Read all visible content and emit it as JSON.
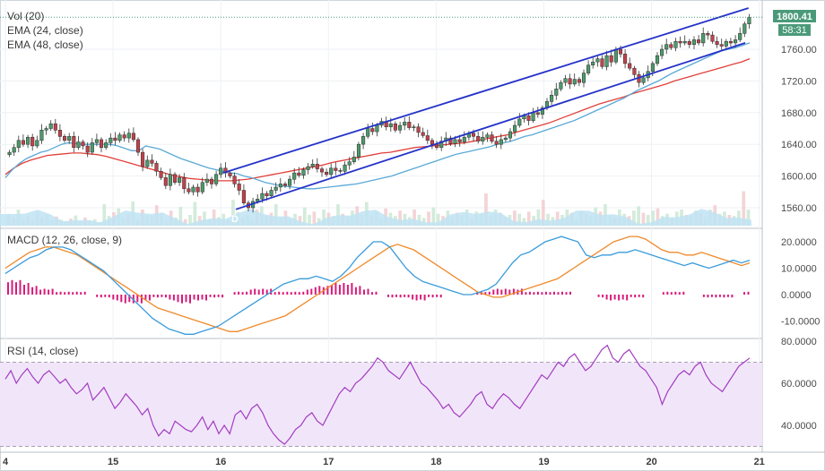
{
  "chart_data": [
    {
      "type": "candlestick",
      "panel": "price",
      "indicator_labels": [
        "Vol (20)",
        "EMA (24, close)",
        "EMA (48, close)"
      ],
      "price_badge": "1800.41",
      "countdown_badge": "58:31",
      "x_tick_labels": [
        "4",
        "15",
        "16",
        "17",
        "18",
        "19",
        "20",
        "21"
      ],
      "y_tick_labels": [
        "1560.00",
        "1600.00",
        "1640.00",
        "1680.00",
        "1720.00",
        "1760.00"
      ],
      "ylim": [
        1540,
        1815
      ],
      "last_price": 1800.41,
      "watermark": "D",
      "closes": [
        1630,
        1636,
        1645,
        1640,
        1649,
        1638,
        1645,
        1658,
        1660,
        1666,
        1658,
        1650,
        1645,
        1650,
        1636,
        1643,
        1638,
        1630,
        1642,
        1646,
        1636,
        1642,
        1648,
        1645,
        1652,
        1648,
        1654,
        1646,
        1630,
        1612,
        1620,
        1616,
        1606,
        1598,
        1588,
        1602,
        1592,
        1598,
        1584,
        1580,
        1586,
        1580,
        1592,
        1596,
        1590,
        1602,
        1610,
        1604,
        1600,
        1590,
        1582,
        1566,
        1560,
        1568,
        1571,
        1578,
        1575,
        1582,
        1586,
        1590,
        1588,
        1596,
        1604,
        1601,
        1608,
        1612,
        1615,
        1609,
        1605,
        1602,
        1610,
        1607,
        1606,
        1614,
        1618,
        1624,
        1640,
        1650,
        1660,
        1656,
        1664,
        1669,
        1662,
        1666,
        1658,
        1664,
        1668,
        1661,
        1662,
        1655,
        1651,
        1645,
        1640,
        1636,
        1644,
        1648,
        1641,
        1646,
        1643,
        1649,
        1654,
        1650,
        1644,
        1649,
        1652,
        1644,
        1640,
        1646,
        1648,
        1656,
        1664,
        1672,
        1676,
        1670,
        1680,
        1678,
        1686,
        1694,
        1702,
        1710,
        1718,
        1723,
        1716,
        1722,
        1718,
        1730,
        1740,
        1744,
        1748,
        1738,
        1752,
        1744,
        1760,
        1754,
        1742,
        1736,
        1728,
        1718,
        1724,
        1732,
        1742,
        1752,
        1760,
        1766,
        1762,
        1770,
        1768,
        1770,
        1766,
        1772,
        1768,
        1780,
        1778,
        1770,
        1766,
        1764,
        1770,
        1768,
        1772,
        1780,
        1792,
        1800
      ],
      "ema24": [
        1598,
        1608,
        1616,
        1622,
        1626,
        1630,
        1632,
        1636,
        1640,
        1642,
        1641,
        1640,
        1640,
        1640,
        1640,
        1640,
        1638,
        1635,
        1632,
        1632,
        1638,
        1636,
        1634,
        1630,
        1626,
        1622,
        1619,
        1616,
        1613,
        1610,
        1608,
        1606,
        1604,
        1603,
        1600,
        1598,
        1595,
        1592,
        1590,
        1588,
        1587,
        1586,
        1585,
        1584,
        1584,
        1585,
        1586,
        1587,
        1588,
        1589,
        1590,
        1592,
        1594,
        1596,
        1598,
        1600,
        1603,
        1606,
        1609,
        1612,
        1615,
        1618,
        1621,
        1624,
        1627,
        1629,
        1631,
        1633,
        1635,
        1637,
        1640,
        1642,
        1644,
        1647,
        1650,
        1652,
        1655,
        1658,
        1661,
        1664,
        1667,
        1670,
        1674,
        1678,
        1682,
        1686,
        1690,
        1694,
        1698,
        1703,
        1708,
        1712,
        1716,
        1720,
        1725,
        1730,
        1734,
        1738,
        1742,
        1746,
        1750,
        1754,
        1758,
        1760,
        1762,
        1765,
        1768
      ],
      "ema48": [
        1602,
        1610,
        1616,
        1620,
        1623,
        1626,
        1627,
        1628,
        1629,
        1629,
        1628,
        1627,
        1625,
        1622,
        1619,
        1616,
        1613,
        1610,
        1607,
        1604,
        1601,
        1599,
        1597,
        1596,
        1595,
        1594,
        1594,
        1594,
        1595,
        1596,
        1598,
        1600,
        1602,
        1604,
        1606,
        1608,
        1610,
        1612,
        1614,
        1617,
        1619,
        1621,
        1623,
        1625,
        1627,
        1629,
        1630,
        1632,
        1634,
        1636,
        1637,
        1638,
        1639,
        1640,
        1641,
        1642,
        1644,
        1646,
        1648,
        1650,
        1652,
        1655,
        1658,
        1661,
        1664,
        1667,
        1671,
        1675,
        1679,
        1683,
        1687,
        1691,
        1694,
        1697,
        1700,
        1704,
        1707,
        1710,
        1713,
        1716,
        1720,
        1723,
        1726,
        1729,
        1732,
        1735,
        1738,
        1741,
        1744,
        1748
      ],
      "volume": [
        22,
        15,
        30,
        12,
        18,
        10,
        25,
        14,
        20,
        9,
        17,
        11,
        8,
        13,
        19,
        7,
        15,
        10,
        12,
        6,
        40,
        18,
        25,
        32,
        14,
        22,
        45,
        12,
        30,
        20,
        16,
        38,
        24,
        10,
        28,
        15,
        35,
        12,
        20,
        44,
        18,
        26,
        12,
        30,
        16,
        22,
        10,
        48,
        25,
        14,
        20,
        12,
        30,
        36,
        18,
        24,
        40,
        16,
        28,
        12,
        22,
        18,
        34,
        20,
        26,
        14,
        30,
        24,
        18,
        40,
        22,
        16,
        28,
        36,
        20,
        44,
        18,
        26,
        14,
        32,
        24,
        18,
        28,
        22,
        16,
        30,
        20,
        14,
        26,
        34,
        22,
        18,
        28,
        16,
        24,
        20,
        30,
        14,
        26,
        22,
        60,
        18,
        30,
        24,
        16,
        20,
        28,
        22,
        14,
        26,
        18,
        30,
        48,
        22,
        16,
        26,
        20,
        30,
        24,
        12,
        28,
        22,
        18,
        34,
        26,
        40,
        20,
        16,
        30,
        22,
        18,
        28,
        36,
        24,
        20,
        28,
        32,
        18,
        22,
        14,
        26,
        30,
        20,
        18,
        28,
        24,
        16,
        30,
        38,
        22,
        26,
        20,
        18,
        28,
        64,
        30
      ],
      "channel_upper": [
        [
          1604,
          16.02
        ],
        [
          1812,
          20.9
        ]
      ],
      "channel_lower": [
        [
          1558,
          16.14
        ],
        [
          1768,
          20.87
        ]
      ]
    },
    {
      "type": "line",
      "panel": "macd",
      "indicator_label": "MACD (12, 26, close, 9)",
      "y_tick_labels": [
        "20.0000",
        "10.0000",
        "0.0000",
        "-10.0000"
      ],
      "ylim": [
        -15,
        25
      ],
      "series": [
        {
          "values": [
            10,
            12,
            14,
            16,
            17,
            18,
            18,
            17,
            16,
            15,
            13,
            11,
            9,
            7,
            5,
            3,
            1,
            -1,
            -3,
            -5,
            -6,
            -7,
            -8,
            -9,
            -10,
            -11,
            -12,
            -13,
            -14,
            -14,
            -13,
            -12,
            -11,
            -10,
            -9,
            -8,
            -6,
            -4,
            -2,
            0,
            2,
            4,
            6,
            8,
            10,
            12,
            14,
            16,
            18,
            19,
            18,
            17,
            15,
            13,
            11,
            9,
            7,
            5,
            3,
            1,
            0,
            -1,
            -1,
            0,
            1,
            2,
            3,
            4,
            5,
            6,
            8,
            10,
            12,
            14,
            16,
            18,
            20,
            21,
            22,
            22,
            21,
            19,
            17,
            16,
            16,
            15,
            15,
            16,
            15,
            14,
            13,
            12,
            11,
            12
          ]
        },
        {
          "values": [
            8,
            10,
            12,
            14,
            15,
            17,
            18,
            18,
            17,
            15,
            13,
            11,
            9,
            6,
            3,
            0,
            -3,
            -6,
            -9,
            -11,
            -13,
            -14,
            -15,
            -15,
            -14,
            -13,
            -12,
            -10,
            -8,
            -6,
            -4,
            -2,
            0,
            2,
            4,
            5,
            6,
            6,
            7,
            6,
            5,
            7,
            10,
            14,
            17,
            20,
            20,
            18,
            14,
            10,
            7,
            5,
            4,
            3,
            2,
            1,
            0,
            0,
            1,
            2,
            4,
            8,
            12,
            15,
            16,
            18,
            20,
            21,
            22,
            21,
            20,
            15,
            14,
            15,
            15,
            16,
            16,
            17,
            16,
            15,
            14,
            13,
            12,
            11,
            12,
            11,
            10,
            11,
            12,
            13,
            12,
            13
          ]
        }
      ],
      "histogram": [
        5,
        5,
        4,
        3,
        2,
        2,
        1,
        1,
        1,
        1,
        0,
        -1,
        -1,
        -2,
        -3,
        -3,
        -3,
        -2,
        -1,
        -1,
        -2,
        -3,
        -3,
        -2,
        -2,
        -1,
        -1,
        0,
        1,
        1,
        2,
        2,
        2,
        1,
        1,
        1,
        1,
        2,
        3,
        3,
        4,
        4,
        4,
        3,
        2,
        1,
        0,
        -1,
        -1,
        -1,
        -2,
        -2,
        -1,
        -1,
        0,
        0,
        0,
        0,
        1,
        1,
        2,
        2,
        2,
        2,
        1,
        1,
        1,
        1,
        1,
        1,
        0,
        0,
        0,
        -1,
        -2,
        -2,
        -2,
        -1,
        -1,
        0,
        0,
        1,
        1,
        1,
        0,
        0,
        -1,
        -1,
        -1,
        -1,
        0,
        1
      ]
    },
    {
      "type": "line",
      "panel": "rsi",
      "indicator_label": "RSI (14, close)",
      "y_tick_labels": [
        "80.0000",
        "60.0000",
        "40.0000"
      ],
      "ylim": [
        26,
        85
      ],
      "band": [
        30,
        70
      ],
      "series": [
        {
          "values": [
            62,
            66,
            60,
            64,
            67,
            63,
            60,
            64,
            66,
            63,
            60,
            62,
            58,
            55,
            57,
            60,
            52,
            55,
            58,
            53,
            48,
            51,
            55,
            52,
            49,
            45,
            48,
            40,
            35,
            38,
            36,
            42,
            40,
            38,
            37,
            40,
            44,
            38,
            42,
            36,
            40,
            36,
            45,
            47,
            43,
            48,
            50,
            46,
            40,
            36,
            33,
            31,
            34,
            38,
            40,
            44,
            46,
            42,
            40,
            45,
            50,
            55,
            58,
            56,
            60,
            62,
            65,
            68,
            72,
            70,
            66,
            64,
            62,
            66,
            70,
            65,
            60,
            58,
            55,
            52,
            48,
            50,
            46,
            44,
            47,
            50,
            54,
            56,
            50,
            48,
            52,
            55,
            53,
            50,
            48,
            52,
            56,
            60,
            64,
            62,
            66,
            70,
            68,
            72,
            74,
            70,
            66,
            68,
            72,
            76,
            78,
            72,
            70,
            74,
            76,
            72,
            68,
            66,
            62,
            58,
            50,
            56,
            60,
            64,
            66,
            64,
            68,
            70,
            64,
            60,
            58,
            56,
            60,
            64,
            68,
            70,
            72
          ]
        }
      ]
    }
  ]
}
